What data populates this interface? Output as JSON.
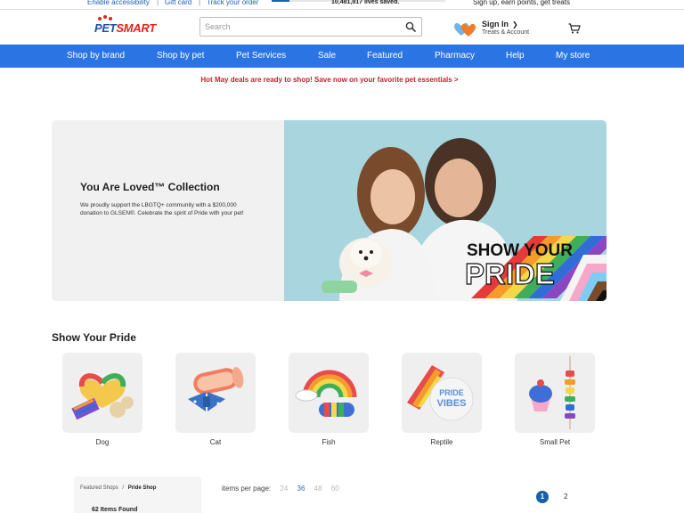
{
  "utility": {
    "accessibility": "Enable accessibility",
    "gift_card": "Gift card",
    "track_order": "Track your order",
    "lives_saved": "10,481,817 lives saved.",
    "signup": "Sign up, earn points, get treats"
  },
  "header": {
    "logo_text_a": "PET",
    "logo_text_b": "SMART",
    "search_placeholder": "Search",
    "search_value": "",
    "signin": "Sign In",
    "account": "Treats & Account"
  },
  "nav": [
    "Shop by brand",
    "Shop by pet",
    "Pet Services",
    "Sale",
    "Featured",
    "Pharmacy",
    "Help",
    "My store"
  ],
  "promo": "Hot May deals are ready to shop! Save now on your favorite pet essentials >",
  "hero": {
    "title": "You Are Loved™ Collection",
    "body": "We proudly support the LBGTQ+ community with a $200,000 donation to GLSEN®. Celebrate the spirit of Pride with your pet!",
    "overlay_line1": "SHOW YOUR",
    "overlay_line2": "PRIDE"
  },
  "section_title": "Show Your Pride",
  "categories": [
    "Dog",
    "Cat",
    "Fish",
    "Reptile",
    "Small Pet"
  ],
  "breadcrumb": {
    "parent": "Featured Shops",
    "separator": "/",
    "current": "Pride Shop"
  },
  "items_found": "62 Items Found",
  "items_per_page": {
    "label": "items per page:",
    "options": [
      "24",
      "36",
      "48",
      "60"
    ],
    "selected": "36"
  },
  "pagination": [
    "1",
    "2"
  ],
  "colors": {
    "nav_bg": "#2b74e4",
    "brand_blue": "#1d4fa8",
    "brand_red": "#e5231b",
    "promo_red": "#c8202c",
    "page_active": "#1560a8"
  }
}
